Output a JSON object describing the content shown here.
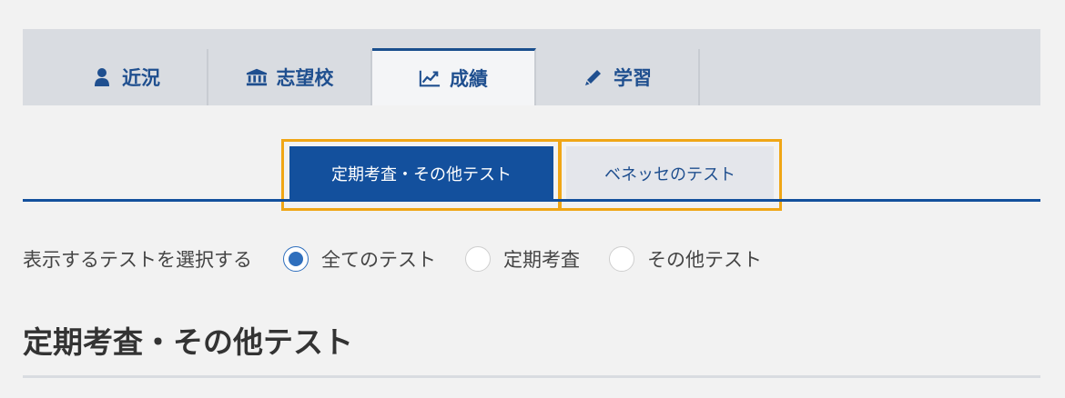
{
  "main_tabs": [
    {
      "label": "近況",
      "icon": "person-icon",
      "active": false
    },
    {
      "label": "志望校",
      "icon": "institution-icon",
      "active": false
    },
    {
      "label": "成績",
      "icon": "line-chart-icon",
      "active": true
    },
    {
      "label": "学習",
      "icon": "pencil-icon",
      "active": false
    }
  ],
  "sub_tabs": [
    {
      "label": "定期考査・その他テスト",
      "selected": true
    },
    {
      "label": "ベネッセのテスト",
      "selected": false
    }
  ],
  "filter": {
    "label": "表示するテストを選択する",
    "options": [
      {
        "label": "全てのテスト",
        "checked": true
      },
      {
        "label": "定期考査",
        "checked": false
      },
      {
        "label": "その他テスト",
        "checked": false
      }
    ]
  },
  "section": {
    "title": "定期考査・その他テスト"
  },
  "colors": {
    "primary": "#13509d",
    "tab_text": "#1f4f8f",
    "highlight": "#f0a616",
    "radio_checked": "#2f6fbd",
    "tab_bar_bg": "#d9dce1"
  }
}
